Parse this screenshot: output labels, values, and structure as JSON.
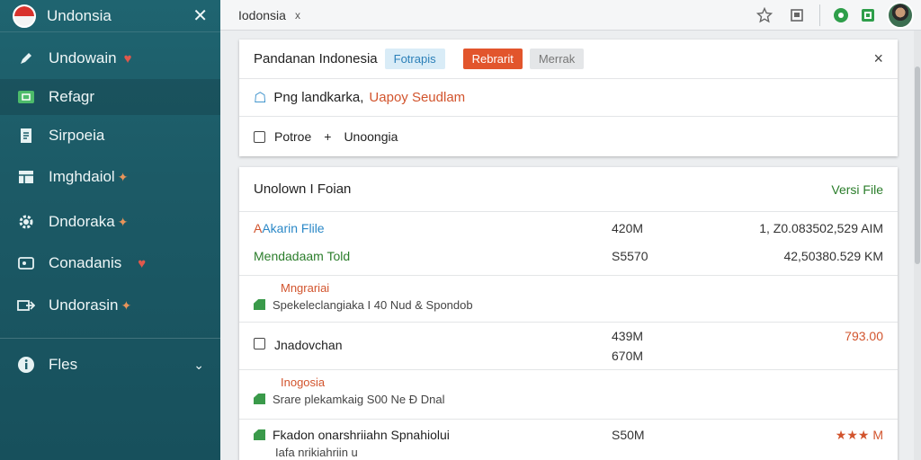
{
  "sidebar": {
    "title": "Undonsia",
    "items": [
      {
        "label": "Undowain",
        "icon": "pencil-icon",
        "badge": "♥"
      },
      {
        "label": "Refagr",
        "icon": "mail-icon",
        "badge": ""
      },
      {
        "label": "Sirpoeia",
        "icon": "document-icon",
        "badge": ""
      },
      {
        "label": "Imghdaiol",
        "icon": "grid-icon",
        "badge": "✦"
      },
      {
        "label": "Dndoraka",
        "icon": "gear-icon",
        "badge": "✦"
      },
      {
        "label": "Conadanis",
        "icon": "contact-card-icon",
        "badge": "♥"
      },
      {
        "label": "Undorasin",
        "icon": "share-icon",
        "badge": "✦"
      }
    ],
    "footer": {
      "label": "Fles",
      "icon": "info-icon"
    }
  },
  "topbar": {
    "tab_title": "Iodonsia",
    "tab_close": "x"
  },
  "panel1": {
    "title": "Pandanan Indonesia",
    "btn1": "Fotrapis",
    "btn2": "Rebrarit",
    "btn3": "Merrak",
    "close": "×",
    "row2_text_a": "Png landkarka,",
    "row2_text_b": "Uapoy Seudlam",
    "row3_label_a": "Potroe",
    "row3_plus": "+",
    "row3_label_b": "Unoongia"
  },
  "panel2": {
    "header_left": "Unolown I Foian",
    "header_right": "Versi File",
    "rows": [
      {
        "name": "Akarin Flile",
        "size": "420M",
        "value": "1, Z0.083502,529 AIM"
      },
      {
        "name": "Mendadaam Told",
        "size": "S5570",
        "value": "42,50380.529 KM"
      },
      {
        "note": "Mngrariai",
        "sub": "Spekeleclangiaka I 40 Nud & Spondob"
      },
      {
        "name": "Jnadovchan",
        "size": "439M",
        "size2": "670M",
        "value": "793.00"
      },
      {
        "note": "Inogosia",
        "sub": "Srare plekamkaig S00 Ne Ð Dnal"
      },
      {
        "name": "Fkadon onarshriiahn Spnahiolui",
        "size": "S50M",
        "value": "★★★ M",
        "sub": "Iafa nrikiahriin u"
      }
    ]
  },
  "colors": {
    "sidebar": "#1d5e6a",
    "accent_orange": "#e2552c",
    "accent_green": "#2b7d2b",
    "accent_blue": "#2b88c7"
  }
}
